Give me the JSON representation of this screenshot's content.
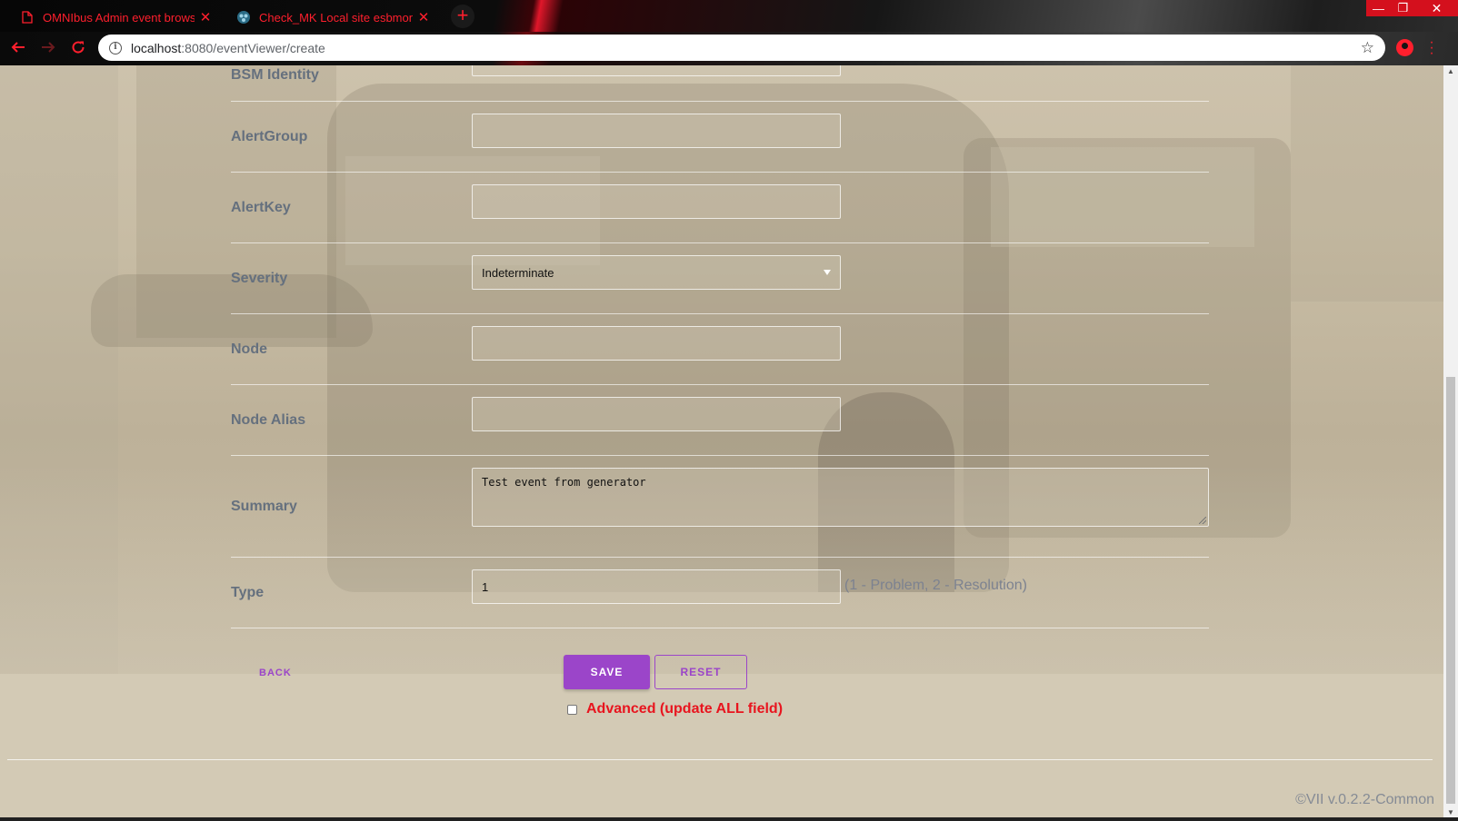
{
  "browser": {
    "tabs": [
      {
        "title": "OMNIbus Admin event browse",
        "active": false
      },
      {
        "title": "Check_MK Local site esbmon",
        "active": true
      }
    ],
    "new_tab_glyph": "+",
    "url_host": "localhost",
    "url_path": ":8080/eventViewer/create",
    "theme_color": "#ff1f2d"
  },
  "form": {
    "fields": [
      {
        "label": "BSM Identity",
        "value": "",
        "kind": "text"
      },
      {
        "label": "AlertGroup",
        "value": "",
        "kind": "text"
      },
      {
        "label": "AlertKey",
        "value": "",
        "kind": "text"
      },
      {
        "label": "Severity",
        "value": "Indeterminate",
        "kind": "select"
      },
      {
        "label": "Node",
        "value": "",
        "kind": "text"
      },
      {
        "label": "Node Alias",
        "value": "",
        "kind": "text"
      },
      {
        "label": "Summary",
        "value": "Test event from generator",
        "kind": "textarea"
      },
      {
        "label": "Type",
        "value": "1",
        "kind": "text",
        "hint": "(1 - Problem, 2 - Resolution)"
      }
    ],
    "accent_color": "#9b45c9"
  },
  "actions": {
    "back_label": "BACK",
    "save_label": "SAVE",
    "reset_label": "RESET",
    "advanced_label": "Advanced (update ALL field)",
    "advanced_checked": false
  },
  "footer": {
    "version": "©VII v.0.2.2-Common"
  }
}
